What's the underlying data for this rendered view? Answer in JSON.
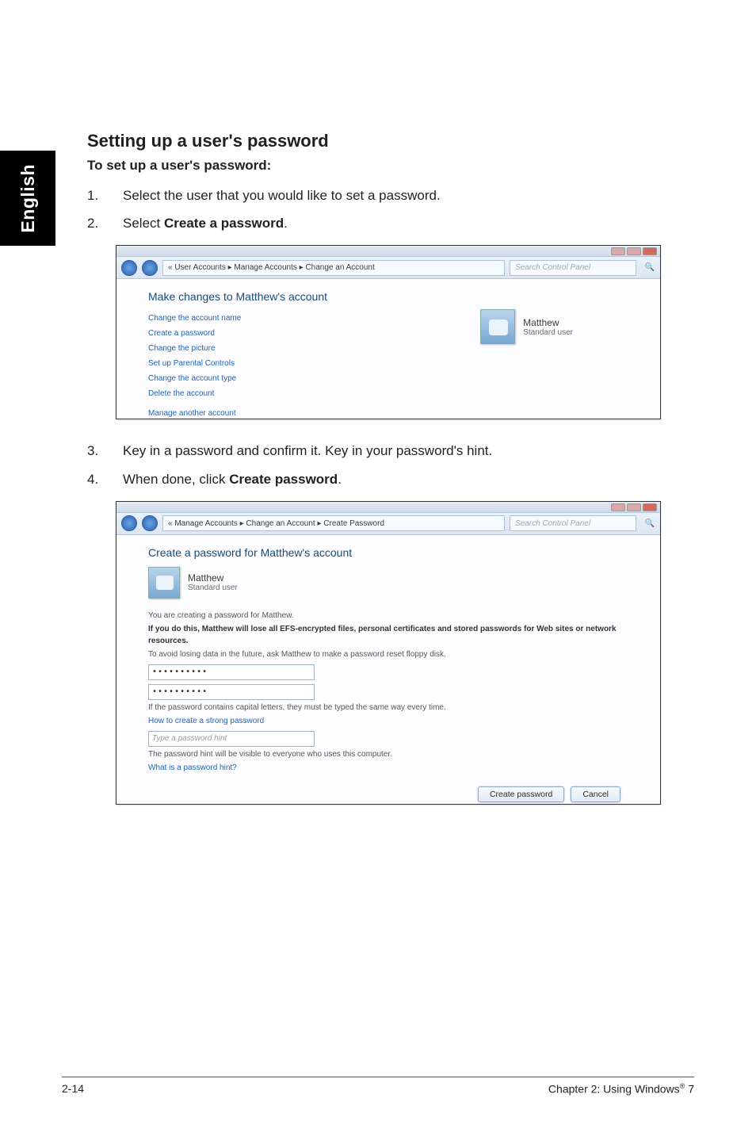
{
  "sidebar": {
    "language": "English"
  },
  "heading": "Setting up a user's password",
  "subheading": "To set up a user's password:",
  "steps": {
    "s1": {
      "num": "1.",
      "text": "Select the user that you would like to set a password."
    },
    "s2": {
      "num": "2.",
      "prefix": "Select ",
      "bold": "Create a password",
      "suffix": "."
    },
    "s3": {
      "num": "3.",
      "text": "Key in a password and confirm it. Key in your password's hint."
    },
    "s4": {
      "num": "4.",
      "prefix": "When done, click ",
      "bold": "Create password",
      "suffix": "."
    }
  },
  "shot1": {
    "breadcrumb": "« User Accounts ▸ Manage Accounts ▸ Change an Account",
    "search_placeholder": "Search Control Panel",
    "title": "Make changes to Matthew's account",
    "links": {
      "l1": "Change the account name",
      "l2": "Create a password",
      "l3": "Change the picture",
      "l4": "Set up Parental Controls",
      "l5": "Change the account type",
      "l6": "Delete the account",
      "l7": "Manage another account"
    },
    "user": {
      "name": "Matthew",
      "role": "Standard user"
    }
  },
  "shot2": {
    "breadcrumb": "« Manage Accounts ▸ Change an Account ▸ Create Password",
    "search_placeholder": "Search Control Panel",
    "title": "Create a password for Matthew's account",
    "user": {
      "name": "Matthew",
      "role": "Standard user"
    },
    "line_creating": "You are creating a password for Matthew.",
    "line_warn": "If you do this, Matthew will lose all EFS-encrypted files, personal certificates and stored passwords for Web sites or network resources.",
    "line_avoid": "To avoid losing data in the future, ask Matthew to make a password reset floppy disk.",
    "pw1": "••••••••••",
    "pw2": "••••••••••",
    "line_caps": "If the password contains capital letters, they must be typed the same way every time.",
    "link_strong": "How to create a strong password",
    "hint_placeholder": "Type a password hint",
    "line_visible": "The password hint will be visible to everyone who uses this computer.",
    "link_hint": "What is a password hint?",
    "btn_create": "Create password",
    "btn_cancel": "Cancel"
  },
  "footer": {
    "left": "2-14",
    "right_prefix": "Chapter 2: Using Windows",
    "right_sup": "®",
    "right_suffix": " 7"
  }
}
